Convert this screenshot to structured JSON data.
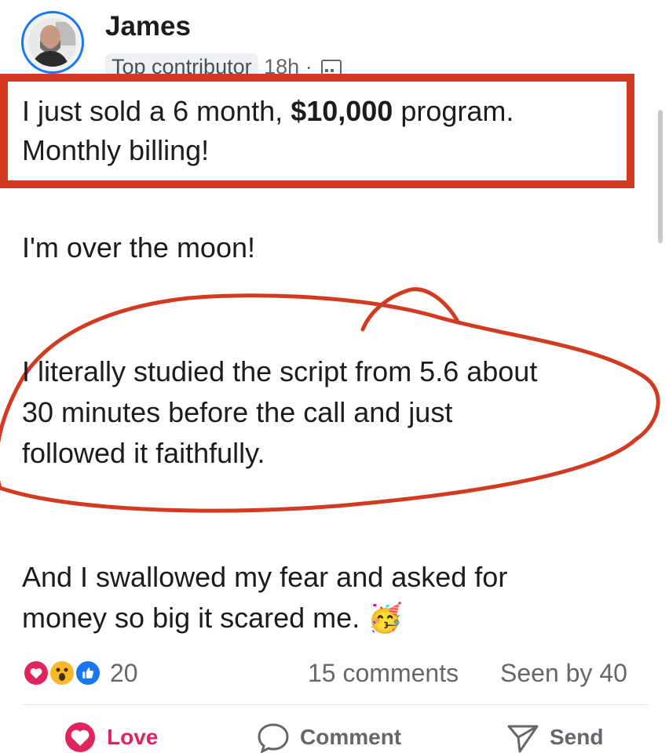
{
  "post": {
    "author": "James",
    "badge": "Top contributor",
    "time": "18h",
    "separator": "·",
    "line1_start": "I just sold a 6 month, ",
    "line1_bold": "$10,000",
    "line1_end": " program.",
    "line2": "Monthly billing!",
    "para2": "I'm over the moon!",
    "para3_l1": "I literally studied the script from 5.6 about",
    "para3_l2": "30 minutes before the call and just",
    "para3_l3": "followed it faithfully.",
    "para4_l1": "And I swallowed my fear and asked for",
    "para4_l2": "money so big it scared me.",
    "emoji": "🥳"
  },
  "stats": {
    "reaction_count": "20",
    "comments": "15 comments",
    "seen": "Seen by 40"
  },
  "actions": {
    "love": "Love",
    "comment": "Comment",
    "send": "Send"
  },
  "colors": {
    "annotation_red": "#d23a22",
    "love": "#e0245e",
    "like_blue": "#1877f2",
    "wow_yellow": "#f7b928"
  },
  "icons": [
    "heart-icon",
    "wow-icon",
    "like-icon",
    "comment-icon",
    "send-icon",
    "globe-icon"
  ]
}
